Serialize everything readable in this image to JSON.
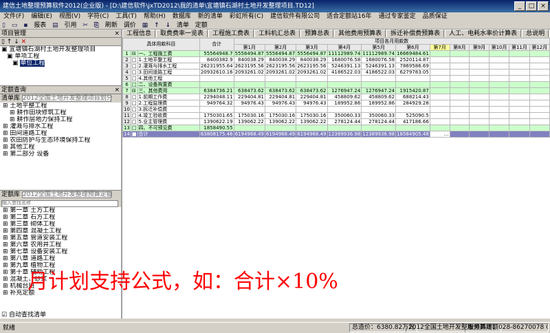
{
  "window": {
    "title": "建信土地整理预算软件2012(企业版) - [D:\\建信软件\\jxTD2012\\我的清单\\宜塘镇石湖村土地开发整理项目.TD12]",
    "min": "_",
    "max": "□",
    "close": "×"
  },
  "menu": [
    "文件(F)",
    "编辑(E)",
    "视图(V)",
    "字符(C)",
    "工具(T)",
    "帮助(H)",
    "数据库",
    "新的清单",
    "彩虹所有(C)",
    "建信软件有限公司",
    "适合定额站16年",
    "通过专家鉴定",
    "品质保证"
  ],
  "toolbar": [
    "报表",
    "引用",
    "刷新",
    "调价",
    "清单",
    "定额"
  ],
  "project": {
    "header": "项目管理",
    "tree": [
      {
        "label": "宜塘镇石湖村土地开发整理项目",
        "level": 0,
        "sel": false
      },
      {
        "label": "单项工程",
        "level": 1,
        "sel": false
      },
      {
        "label": "单位工程",
        "level": 2,
        "sel": true
      }
    ]
  },
  "quota": {
    "header": "定额查询",
    "combo_label": "清单库",
    "combo_value": "2012全国土地开发整理项目划分",
    "items": [
      "土地平整工程",
      "耕作田块修筑工程",
      "耕作层地力保持工程",
      "灌溉与排水工程",
      "田间道路工程",
      "农田防护与生态环境保持工程",
      "其他工程",
      "第二部分 设备"
    ]
  },
  "library": {
    "combo_label": "定额库",
    "combo_value": "2012全国土地开发整理预算定额",
    "search_placeholder": "输入查找名称",
    "items": [
      "第一章 土方工程",
      "第二章 石方工程",
      "第三章 砌体工程",
      "第四章 混凝土工程",
      "第五章 管道安装工程",
      "第六章 农用井工程",
      "第七章 设备安装工程",
      "第八章 道路工程",
      "第九章 植物工程",
      "第十章 辅助工程",
      "混凝土、砂浆",
      "机械台班",
      "补充定额"
    ],
    "autofind": "自动查找清单"
  },
  "tabs": [
    "工程信息",
    "取费费率一览表",
    "工程施工费表",
    "工料机汇总表",
    "预算总表",
    "其他费用预算表",
    "拆迁补偿费预算表",
    "人工、电耗水率价计算表",
    "总说明",
    "分年预算表",
    "分月计划表"
  ],
  "active_tab": "分月计划表",
  "table": {
    "h_name": "具体用款科目",
    "h_total": "合计",
    "h_group": "项目各月用款数",
    "months": [
      "第1月",
      "第2月",
      "第3月",
      "第4月",
      "第5月",
      "第6月",
      "第7月",
      "第8月",
      "第9月",
      "第10月",
      "第11月",
      "第12月"
    ],
    "rows": [
      {
        "no": "1",
        "mark": "⊟",
        "name": "一、工程施工费",
        "total": "55564948.7",
        "m": [
          "5556494.87",
          "5556494.87",
          "5556494.87",
          "11112989.74",
          "11112989.74",
          "16669484.61"
        ],
        "green": true
      },
      {
        "no": "2",
        "mark": "□",
        "name": "1.土地平整工程",
        "total": "8400382.9",
        "m": [
          "840038.29",
          "840038.29",
          "840038.29",
          "1680076.58",
          "1680076.58",
          "2520114.87"
        ],
        "green": false
      },
      {
        "no": "3",
        "mark": "□",
        "name": "2.灌溉与排水工程",
        "total": "26231955.64",
        "m": [
          "2623195.56",
          "2623195.56",
          "2623195.56",
          "5246391.13",
          "5246391.13",
          "7869586.69"
        ],
        "green": false
      },
      {
        "no": "4",
        "mark": "□",
        "name": "3.田间道路工程",
        "total": "20932610.16",
        "m": [
          "2093261.02",
          "2093261.02",
          "2093261.02",
          "4186522.03",
          "4186522.03",
          "6279783.05"
        ],
        "green": false
      },
      {
        "no": "5",
        "mark": "□",
        "name": "4.其他工程",
        "total": "",
        "m": [
          "",
          "",
          "",
          "",
          "",
          ""
        ],
        "green": false
      },
      {
        "no": "6",
        "mark": "□",
        "name": "二、设备购置费",
        "total": "",
        "m": [
          "",
          "",
          "",
          "",
          "",
          ""
        ],
        "green": true
      },
      {
        "no": "7",
        "mark": "⊟",
        "name": "三、其他费用",
        "total": "6384736.21",
        "m": [
          "638473.62",
          "638473.62",
          "638473.62",
          "1276947.24",
          "1276947.24",
          "1915420.87"
        ],
        "green": true
      },
      {
        "no": "8",
        "mark": "□",
        "name": "1.前期工作费",
        "total": "2294048.11",
        "m": [
          "229404.81",
          "229404.81",
          "229404.81",
          "458809.62",
          "458809.62",
          "688214.43"
        ],
        "green": false
      },
      {
        "no": "9",
        "mark": "□",
        "name": "2.工程监理费",
        "total": "949764.32",
        "m": [
          "94976.43",
          "94976.43",
          "94976.43",
          "189952.86",
          "189952.86",
          "284929.28"
        ],
        "green": false
      },
      {
        "no": "10",
        "mark": "□",
        "name": "3.拆迁补偿费",
        "total": "",
        "m": [
          "",
          "",
          "",
          "",
          "",
          ""
        ],
        "green": false
      },
      {
        "no": "11",
        "mark": "□",
        "name": "4.竣工验收费",
        "total": "1750301.65",
        "m": [
          "175030.16",
          "175030.16",
          "175030.16",
          "350060.33",
          "350060.33",
          "525090.5"
        ],
        "green": false
      },
      {
        "no": "12",
        "mark": "□",
        "name": "5.业主管理费",
        "total": "1390622.19",
        "m": [
          "139062.22",
          "139062.22",
          "139062.22",
          "278124.44",
          "278124.44",
          "417186.66"
        ],
        "green": false
      },
      {
        "no": "13",
        "mark": "□",
        "name": "四、不可预见费",
        "total": "1858490.55",
        "m": [
          "",
          "",
          "",
          "",
          "",
          ""
        ],
        "green": true
      },
      {
        "no": "14",
        "mark": "■",
        "name": "合计",
        "total": "63808175.46",
        "m": [
          "6194968.49",
          "6194968.49",
          "6194968.49",
          "12389936.98",
          "12389936.98",
          "18584905.48"
        ],
        "green": false,
        "totalrow": true
      }
    ]
  },
  "overlay": "月计划支持公式，如：合计×10%",
  "status": {
    "left": "就绪",
    "total": "总造价：6380.82万元",
    "lib": "2012全国土地开发整理预算定额",
    "hotline": "服务热线：028-86270078 QQ:188150708"
  }
}
